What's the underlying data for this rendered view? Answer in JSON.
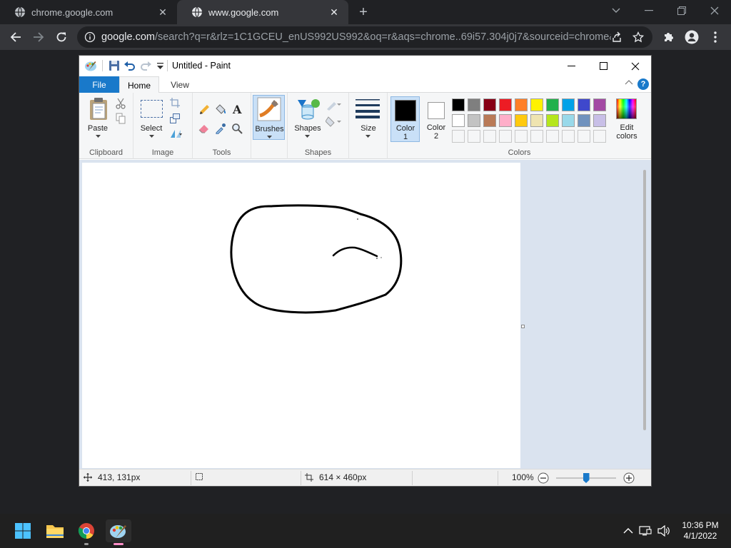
{
  "chrome": {
    "tabs": [
      {
        "title": "chrome.google.com"
      },
      {
        "title": "www.google.com"
      }
    ],
    "url_host": "google.com",
    "url_rest": "/search?q=r&rlz=1C1GCEU_enUS992US992&oq=r&aqs=chrome..69i57.304j0j7&sourceid=chrome&..."
  },
  "paint": {
    "title": "Untitled - Paint",
    "ribbon_tabs": {
      "file": "File",
      "home": "Home",
      "view": "View"
    },
    "groups": {
      "clipboard": "Clipboard",
      "image": "Image",
      "tools": "Tools",
      "shapes": "Shapes",
      "colors": "Colors"
    },
    "buttons": {
      "paste": "Paste",
      "select": "Select",
      "brushes": "Brushes",
      "shapes": "Shapes",
      "size": "Size",
      "color1_a": "Color",
      "color1_b": "1",
      "color2_a": "Color",
      "color2_b": "2",
      "edit_a": "Edit",
      "edit_b": "colors"
    },
    "palette_row1": [
      "#000000",
      "#7f7f7f",
      "#880015",
      "#ed1c24",
      "#ff7f27",
      "#fff200",
      "#22b14c",
      "#00a2e8",
      "#3f48cc",
      "#a349a4"
    ],
    "palette_row2": [
      "#ffffff",
      "#c3c3c3",
      "#b97a57",
      "#ffaec9",
      "#ffc90e",
      "#efe4b0",
      "#b5e61d",
      "#99d9ea",
      "#7092be",
      "#c8bfe7"
    ],
    "color1": "#000000",
    "color2": "#ffffff",
    "status": {
      "cursor": "413, 131px",
      "canvas_size": "614 × 460px",
      "zoom": "100%",
      "zoom_level": 0.5
    }
  },
  "taskbar": {
    "time": "10:36 PM",
    "date": "4/1/2022"
  }
}
